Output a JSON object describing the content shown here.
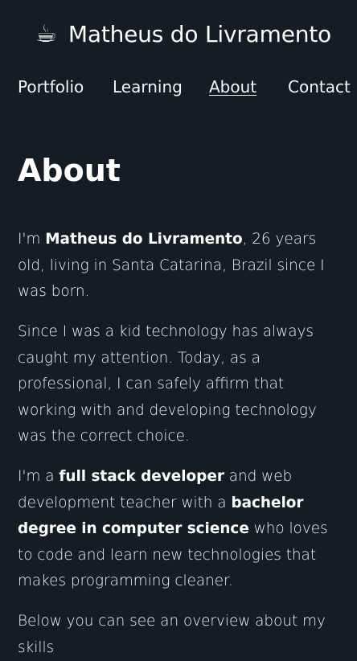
{
  "header": {
    "brand_icon": "☕",
    "brand_icon_name": "coffee-cup-icon",
    "brand_name": "Matheus do Livramento"
  },
  "nav": {
    "items": [
      {
        "label": "Portfolio"
      },
      {
        "label": "Learning"
      },
      {
        "label": "About",
        "active": true
      },
      {
        "label": "Contact"
      }
    ]
  },
  "main": {
    "title": "About",
    "p1": {
      "prefix": "I'm ",
      "name": "Matheus do Livramento",
      "rest": ", 26 years old, living in Santa Catarina, Brazil since I was born."
    },
    "p2": {
      "text": "Since I was a kid technology has always caught my attention. Today, as a professional, I can safely affirm that working with and developing technology was the correct choice."
    },
    "p3": {
      "prefix": "I'm a ",
      "role": "full stack developer",
      "middle": " and web development teacher with a ",
      "degree": "bachelor degree in computer science",
      "rest": " who loves to code and learn new technologies that makes programming cleaner."
    },
    "p4": {
      "text": "Below you can see an overview about my skills"
    }
  },
  "colors": {
    "background": "#161c24",
    "text": "#ffffff"
  }
}
